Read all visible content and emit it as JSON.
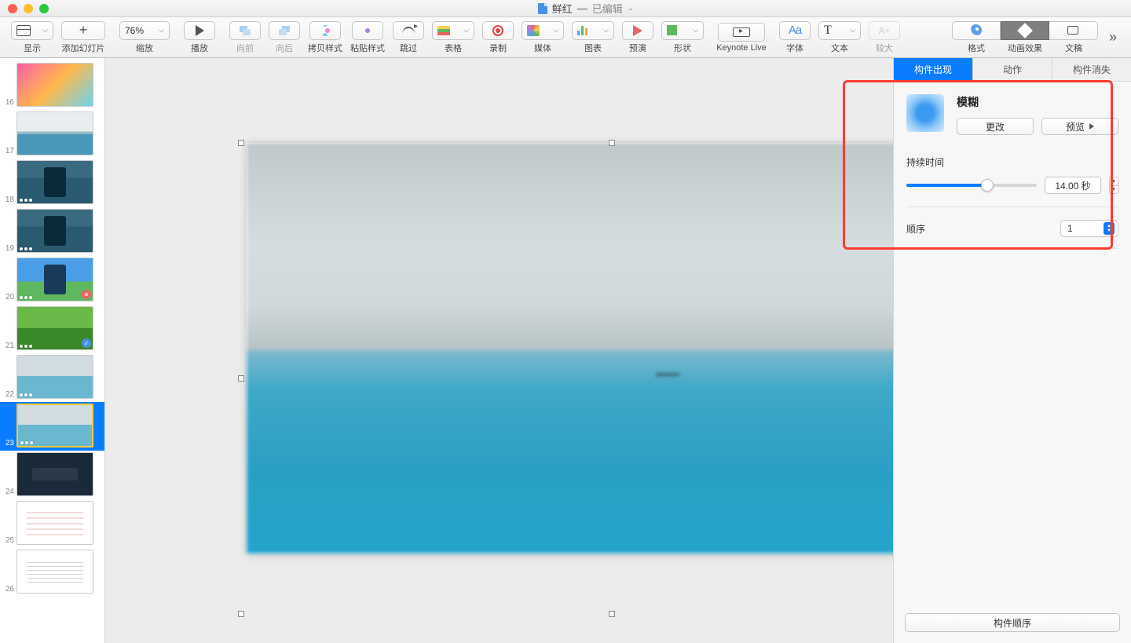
{
  "title": {
    "filename": "鲜红",
    "status": "已编辑"
  },
  "toolbar": {
    "view": "显示",
    "add": "添加幻灯片",
    "zoom": "76%",
    "zoom_label": "缩放",
    "play": "播放",
    "forward": "向前",
    "backward": "向后",
    "copyfmt": "拷贝样式",
    "pastefmt": "粘贴样式",
    "skip": "跳过",
    "table": "表格",
    "record": "录制",
    "media": "媒体",
    "chart": "图表",
    "preview": "预演",
    "shape": "形状",
    "live": "Keynote Live",
    "font": "字体",
    "text": "文本",
    "bigger": "较大",
    "format": "格式",
    "animate": "动画效果",
    "document": "文稿"
  },
  "slides": [
    {
      "n": 16,
      "cls": "th-gradient",
      "dots": false
    },
    {
      "n": 17,
      "cls": "th-lake",
      "dots": false
    },
    {
      "n": 18,
      "cls": "th-lake-phone",
      "dots": true
    },
    {
      "n": 19,
      "cls": "th-lake-phone",
      "dots": true
    },
    {
      "n": 20,
      "cls": "th-sky",
      "dots": true,
      "badge": "cancel"
    },
    {
      "n": 21,
      "cls": "th-green",
      "dots": true,
      "badge": "ok"
    },
    {
      "n": 22,
      "cls": "th-lake2",
      "dots": true
    },
    {
      "n": 23,
      "cls": "th-lake2",
      "dots": true,
      "selected": true
    },
    {
      "n": 24,
      "cls": "th-dark",
      "dots": false
    },
    {
      "n": 25,
      "cls": "th-white1",
      "dots": false
    },
    {
      "n": 26,
      "cls": "th-white2",
      "dots": false
    }
  ],
  "inspector": {
    "tabs": {
      "in": "构件出现",
      "action": "动作",
      "out": "构件消失"
    },
    "effect_name": "模糊",
    "change_btn": "更改",
    "preview_btn": "预览",
    "duration_label": "持续时间",
    "duration_value": "14.00 秒",
    "slider_pct": 62,
    "order_label": "顺序",
    "order_value": "1",
    "footer_btn": "构件顺序"
  }
}
